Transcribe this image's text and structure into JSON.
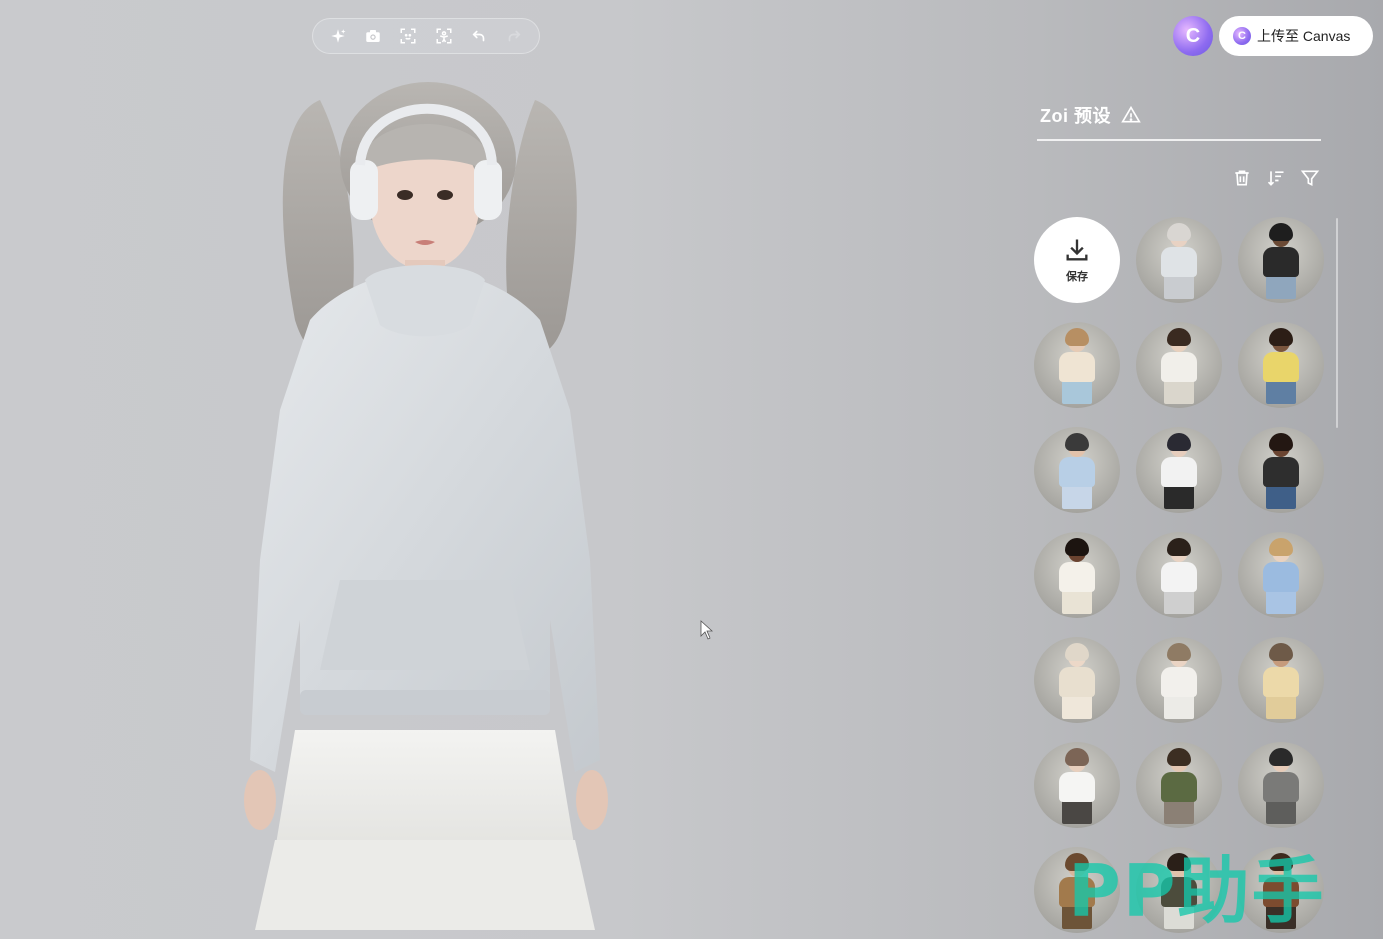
{
  "toolbar": {
    "items": [
      {
        "icon": "sparkle-icon"
      },
      {
        "icon": "camera-icon"
      },
      {
        "icon": "face-focus-icon"
      },
      {
        "icon": "body-focus-icon"
      },
      {
        "icon": "undo-icon"
      },
      {
        "icon": "redo-icon"
      }
    ]
  },
  "header": {
    "app_logo_glyph": "C",
    "upload_label": "上传至 Canvas"
  },
  "panel": {
    "title": "Zoi 预设",
    "save_label": "保存",
    "tools": [
      "delete-icon",
      "sort-icon",
      "filter-icon"
    ],
    "presets": [
      {
        "hair": "#d9d6d2",
        "skin": "#e8d2c3",
        "top": "#dfe3e6",
        "bottom": "#c9ccd0"
      },
      {
        "hair": "#1e1e1e",
        "skin": "#6b4a35",
        "top": "#2a2a2a",
        "bottom": "#8fa6bd"
      },
      {
        "hair": "#b78f63",
        "skin": "#e7cbb5",
        "top": "#efe4d3",
        "bottom": "#a9c7da"
      },
      {
        "hair": "#3a2a20",
        "skin": "#e8d0bd",
        "top": "#f1efea",
        "bottom": "#dad6cc"
      },
      {
        "hair": "#2c1e16",
        "skin": "#7a553d",
        "top": "#e9d56a",
        "bottom": "#5f7fa3"
      },
      {
        "hair": "#3a3a3a",
        "skin": "#e2c2ab",
        "top": "#b8cfe6",
        "bottom": "#c7d6e8"
      },
      {
        "hair": "#2a2a33",
        "skin": "#e6cdbd",
        "top": "#f2f2f2",
        "bottom": "#2a2a2a"
      },
      {
        "hair": "#231712",
        "skin": "#6b4532",
        "top": "#2e2e2e",
        "bottom": "#3f5f88"
      },
      {
        "hair": "#1c1410",
        "skin": "#6a4330",
        "top": "#f4f1ea",
        "bottom": "#e9e3d5"
      },
      {
        "hair": "#2b211a",
        "skin": "#e9d3c3",
        "top": "#f3f3f3",
        "bottom": "#cfcfcf"
      },
      {
        "hair": "#c9a36c",
        "skin": "#ead2bf",
        "top": "#9bbbe0",
        "bottom": "#a9c4e4"
      },
      {
        "hair": "#e0d7c9",
        "skin": "#ecd8c8",
        "top": "#e8dfcf",
        "bottom": "#efe7da"
      },
      {
        "hair": "#8f7b64",
        "skin": "#ead4c4",
        "top": "#f2f0ec",
        "bottom": "#ecebe7"
      },
      {
        "hair": "#6e5a48",
        "skin": "#c69b7c",
        "top": "#ecd9a9",
        "bottom": "#e1cc9a"
      },
      {
        "hair": "#7c6556",
        "skin": "#e8cfbd",
        "top": "#f5f5f3",
        "bottom": "#4a4744"
      },
      {
        "hair": "#3c2e22",
        "skin": "#e3c7b2",
        "top": "#5b6a42",
        "bottom": "#8b8075"
      },
      {
        "hair": "#2a2a2a",
        "skin": "#e6cbb8",
        "top": "#7a7a78",
        "bottom": "#5e5e5c"
      },
      {
        "hair": "#6b4a2f",
        "skin": "#d8b59a",
        "top": "#a27a4c",
        "bottom": "#6d5438"
      },
      {
        "hair": "#2a1f18",
        "skin": "#e0c2aa",
        "top": "#4c4c3c",
        "bottom": "#dcdcd6"
      },
      {
        "hair": "#3d2a1e",
        "skin": "#ddbfa6",
        "top": "#7c4b2f",
        "bottom": "#3a2f27"
      }
    ]
  },
  "watermark": "PP助手"
}
